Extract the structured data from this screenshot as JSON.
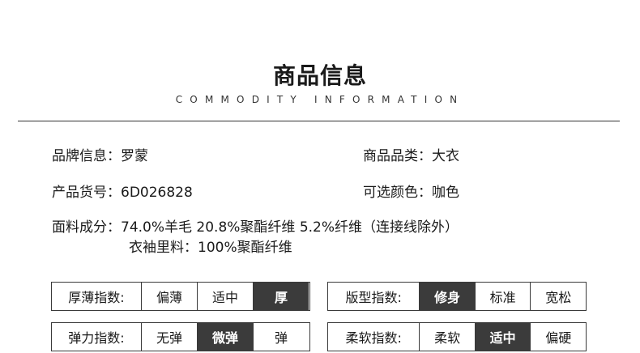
{
  "header": {
    "title": "商品信息",
    "subtitle": "COMMODITY INFORMATION"
  },
  "info": {
    "brand": {
      "label": "品牌信息：",
      "value": "罗蒙"
    },
    "category": {
      "label": "商品品类：",
      "value": "大衣"
    },
    "item_no": {
      "label": "产品货号：",
      "value": "6D026828"
    },
    "color": {
      "label": "可选颜色：",
      "value": "咖色"
    },
    "fabric": {
      "label": "面料成分：",
      "value": "74.0%羊毛 20.8%聚酯纤维 5.2%纤维（连接线除外）"
    },
    "lining": "衣袖里料：100%聚酯纤维"
  },
  "indexes": [
    {
      "label": "厚薄指数:",
      "options": [
        "偏薄",
        "适中",
        "厚"
      ],
      "selected": "厚"
    },
    {
      "label": "版型指数:",
      "options": [
        "修身",
        "标准",
        "宽松"
      ],
      "selected": "修身"
    },
    {
      "label": "弹力指数:",
      "options": [
        "无弹",
        "微弹",
        "弹"
      ],
      "selected": "微弹"
    },
    {
      "label": "柔软指数:",
      "options": [
        "柔软",
        "适中",
        "偏硬"
      ],
      "selected": "适中"
    }
  ],
  "colors": {
    "selected_bg": "#3b3b3b",
    "border": "#3a3a3a"
  }
}
